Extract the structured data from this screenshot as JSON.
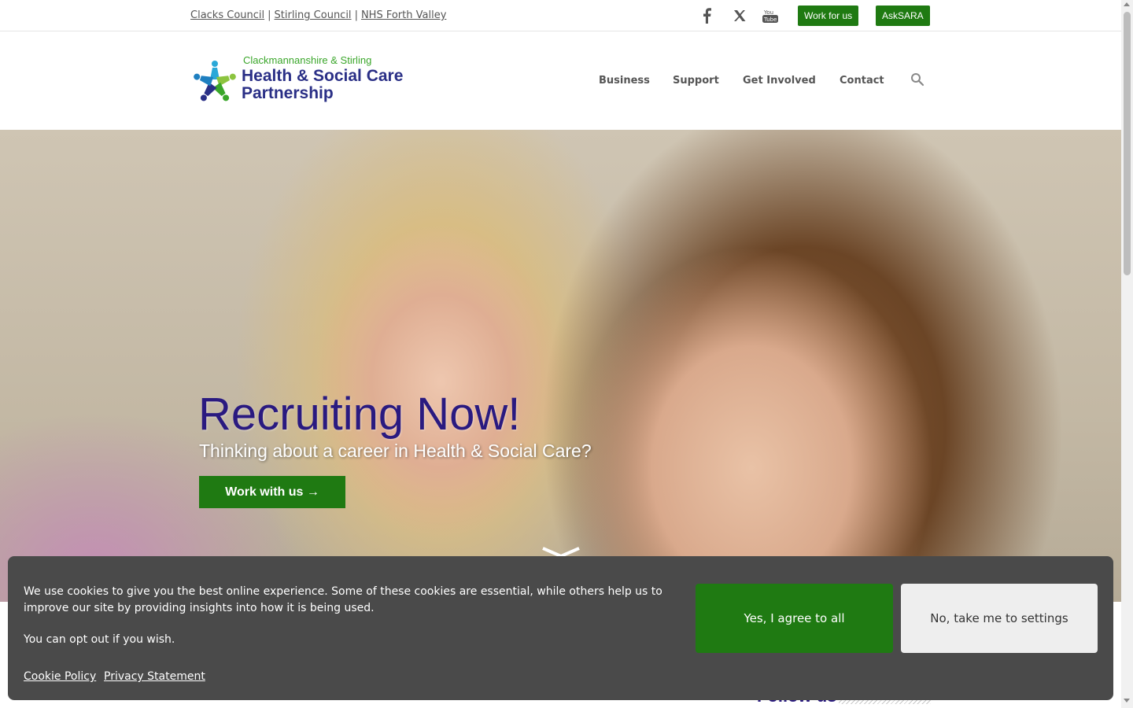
{
  "topbar": {
    "links": [
      "Clacks Council",
      "Stirling Council",
      "NHS Forth Valley"
    ],
    "separator": "|",
    "social": [
      "facebook-icon",
      "x-icon",
      "youtube-icon"
    ],
    "youtube_text": [
      "You",
      "Tube"
    ],
    "buttons": [
      "Work for us",
      "AskSARA"
    ]
  },
  "header": {
    "logo_sub": "Clackmannanshire & Stirling",
    "logo_line1": "Health & Social Care",
    "logo_line2": "Partnership",
    "nav": [
      "Business",
      "Support",
      "Get Involved",
      "Contact"
    ],
    "search_icon": "search-icon"
  },
  "hero": {
    "title": "Recruiting Now!",
    "subtitle": "Thinking about a career in Health & Social Care?",
    "cta": "Work with us →"
  },
  "sidebar": {
    "follow_title": "Follow us"
  },
  "cookie": {
    "text": "We use cookies to give you the best online experience. Some of these cookies are essential, while others help us to improve our site by providing insights into how it is being used.",
    "optout": "You can opt out if you wish.",
    "links": [
      "Cookie Policy",
      "Privacy Statement"
    ],
    "agree": "Yes, I agree to all",
    "settings": "No, take me to settings"
  },
  "colors": {
    "brand_green": "#1f7a12",
    "brand_navy": "#2a2f86",
    "hero_title": "#2a1a80",
    "cookie_bg": "#4a4a4a"
  }
}
